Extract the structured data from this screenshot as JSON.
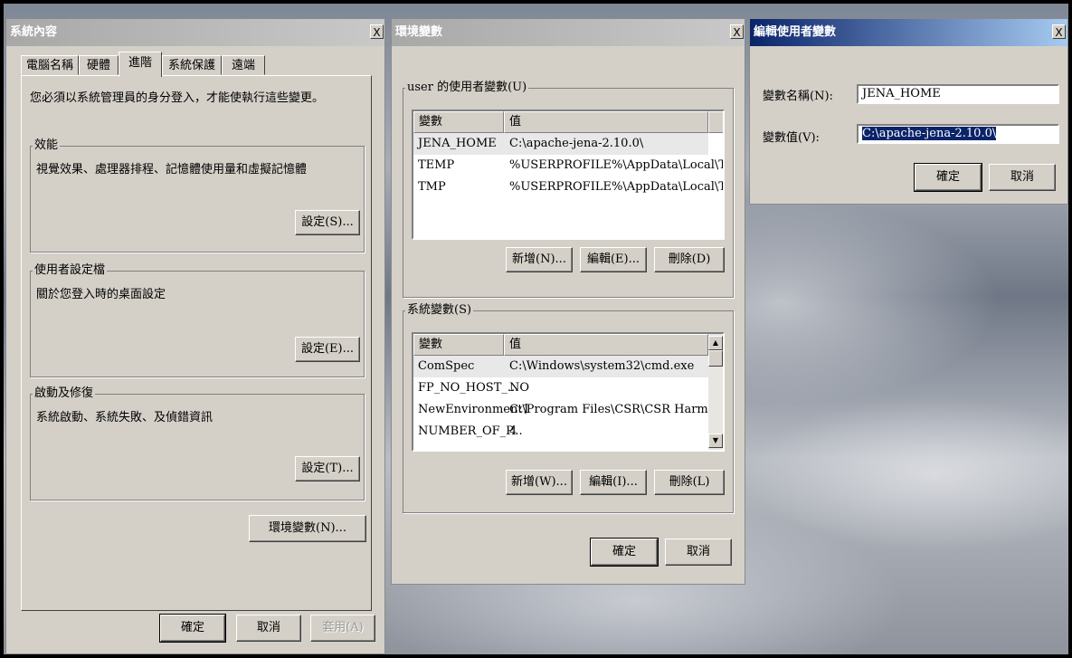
{
  "system_properties": {
    "title": "系統內容",
    "close": "X",
    "tabs": [
      "電腦名稱",
      "硬體",
      "進階",
      "系統保護",
      "遠端"
    ],
    "admin_notice": "您必須以系統管理員的身分登入，才能使執行這些變更。",
    "performance": {
      "label": "效能",
      "description": "視覺效果、處理器排程、記憶體使用量和虛擬記憶體",
      "button": "設定(S)..."
    },
    "user_profiles": {
      "label": "使用者設定檔",
      "description": "關於您登入時的桌面設定",
      "button": "設定(E)..."
    },
    "startup_recovery": {
      "label": "啟動及修復",
      "description": "系統啟動、系統失敗、及偵錯資訊",
      "button": "設定(T)..."
    },
    "env_button": "環境變數(N)...",
    "ok": "確定",
    "cancel": "取消",
    "apply": "套用(A)"
  },
  "env_vars": {
    "title": "環境變數",
    "close": "X",
    "user_group_label": "user 的使用者變數(U)",
    "headers": {
      "var": "變數",
      "val": "值"
    },
    "user_vars": [
      {
        "name": "JENA_HOME",
        "value": "C:\\apache-jena-2.10.0\\"
      },
      {
        "name": "TEMP",
        "value": "%USERPROFILE%\\AppData\\Local\\Temp"
      },
      {
        "name": "TMP",
        "value": "%USERPROFILE%\\AppData\\Local\\Temp"
      }
    ],
    "user_buttons": {
      "new": "新增(N)...",
      "edit": "編輯(E)...",
      "delete": "刪除(D)"
    },
    "system_group_label": "系統變數(S)",
    "system_vars": [
      {
        "name": "ComSpec",
        "value": "C:\\Windows\\system32\\cmd.exe"
      },
      {
        "name": "FP_NO_HOST_...",
        "value": "NO"
      },
      {
        "name": "NewEnvironment1",
        "value": "C:\\Program Files\\CSR\\CSR Harmony Wir..."
      },
      {
        "name": "NUMBER_OF_P...",
        "value": "4"
      }
    ],
    "system_buttons": {
      "new": "新增(W)...",
      "edit": "編輯(I)...",
      "delete": "刪除(L)"
    },
    "ok": "確定",
    "cancel": "取消"
  },
  "edit_var": {
    "title": "編輯使用者變數",
    "close": "X",
    "name_label": "變數名稱(N):",
    "name_value": "JENA_HOME",
    "value_label": "變數值(V):",
    "value_value": "C:\\apache-jena-2.10.0\\",
    "ok": "確定",
    "cancel": "取消"
  },
  "colors": {
    "title_active": "#0a246a",
    "dialog_bg": "#d4d0c8",
    "selection": "#0a246a"
  }
}
